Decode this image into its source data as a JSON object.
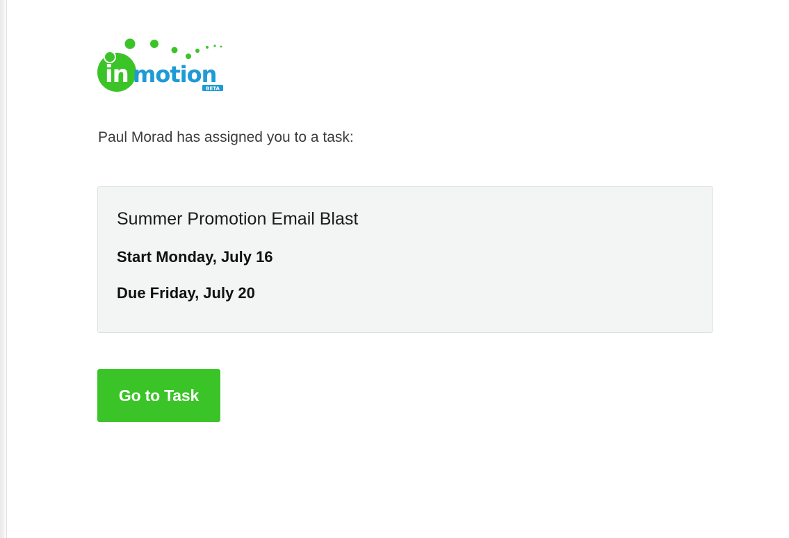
{
  "brand": {
    "logo_mark": "in",
    "logo_word": "motion",
    "logo_badge": "BETA",
    "green": "#3bc428",
    "blue": "#1e9ad6"
  },
  "message": {
    "intro": "Paul Morad has assigned you to a task:"
  },
  "task": {
    "title": "Summer Promotion Email Blast",
    "start": "Start Monday, July 16",
    "due": "Due Friday, July 20"
  },
  "actions": {
    "go_to_task_label": "Go to Task"
  }
}
